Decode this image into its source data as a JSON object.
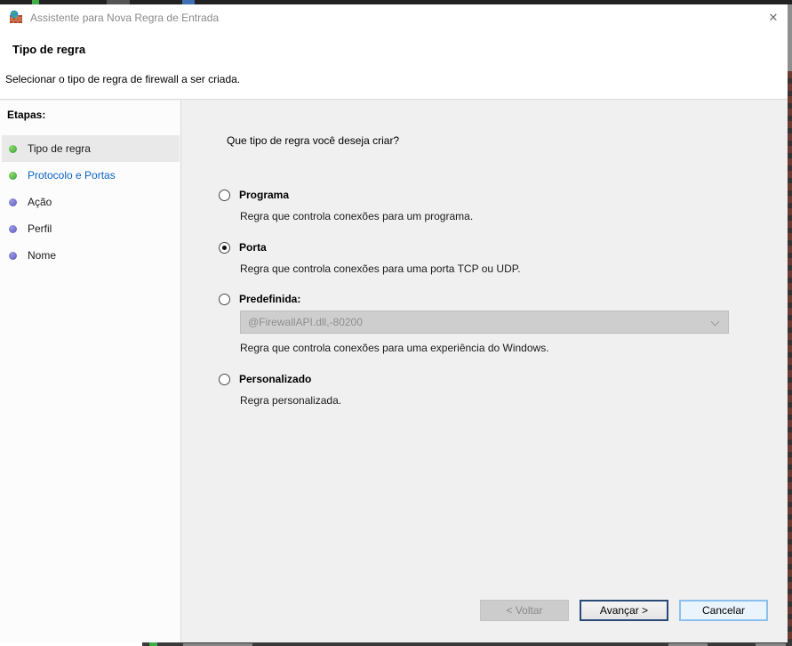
{
  "window": {
    "title": "Assistente para Nova Regra de Entrada",
    "close_glyph": "✕"
  },
  "header": {
    "title": "Tipo de regra",
    "subtitle": "Selecionar o tipo de regra de firewall a ser criada."
  },
  "sidebar": {
    "heading": "Etapas:",
    "items": [
      {
        "label": "Tipo de regra",
        "state": "current",
        "bullet": "green"
      },
      {
        "label": "Protocolo e Portas",
        "state": "link",
        "bullet": "green"
      },
      {
        "label": "Ação",
        "state": "upcoming",
        "bullet": "slate"
      },
      {
        "label": "Perfil",
        "state": "upcoming",
        "bullet": "slate"
      },
      {
        "label": "Nome",
        "state": "upcoming",
        "bullet": "slate"
      }
    ]
  },
  "main": {
    "question": "Que tipo de regra você deseja criar?",
    "options": [
      {
        "label": "Programa",
        "description": "Regra que controla conexões para um programa.",
        "selected": false
      },
      {
        "label": "Porta",
        "description": "Regra que controla conexões para uma porta TCP ou UDP.",
        "selected": true
      },
      {
        "label": "Predefinida:",
        "description": "Regra que controla conexões para uma experiência do Windows.",
        "selected": false,
        "dropdown_value": "@FirewallAPI.dll,-80200",
        "dropdown_disabled": true
      },
      {
        "label": "Personalizado",
        "description": "Regra personalizada.",
        "selected": false
      }
    ]
  },
  "footer": {
    "back_label": "< Voltar",
    "next_label": "Avançar >",
    "cancel_label": "Cancelar",
    "back_disabled": true
  },
  "icons": {
    "app_icon": "firewall-brick-wall-with-globe",
    "dropdown_icon": "chevron-down",
    "close_icon": "close-x"
  },
  "colors": {
    "main_bg": "#f0f0f0",
    "sidebar_bg": "#fcfcfc",
    "selected_step_bg": "#e9e9e9",
    "step_done_green": "#3fae49",
    "step_pending_purple": "#6f6cc8",
    "link_blue": "#0a63c4",
    "disabled_control_bg": "#cecece",
    "default_button_border": "#29497b",
    "cancel_button_border": "#8cc0ec",
    "cancel_button_bg": "#e9f4fd",
    "title_text_gray": "#8a8a8a"
  }
}
